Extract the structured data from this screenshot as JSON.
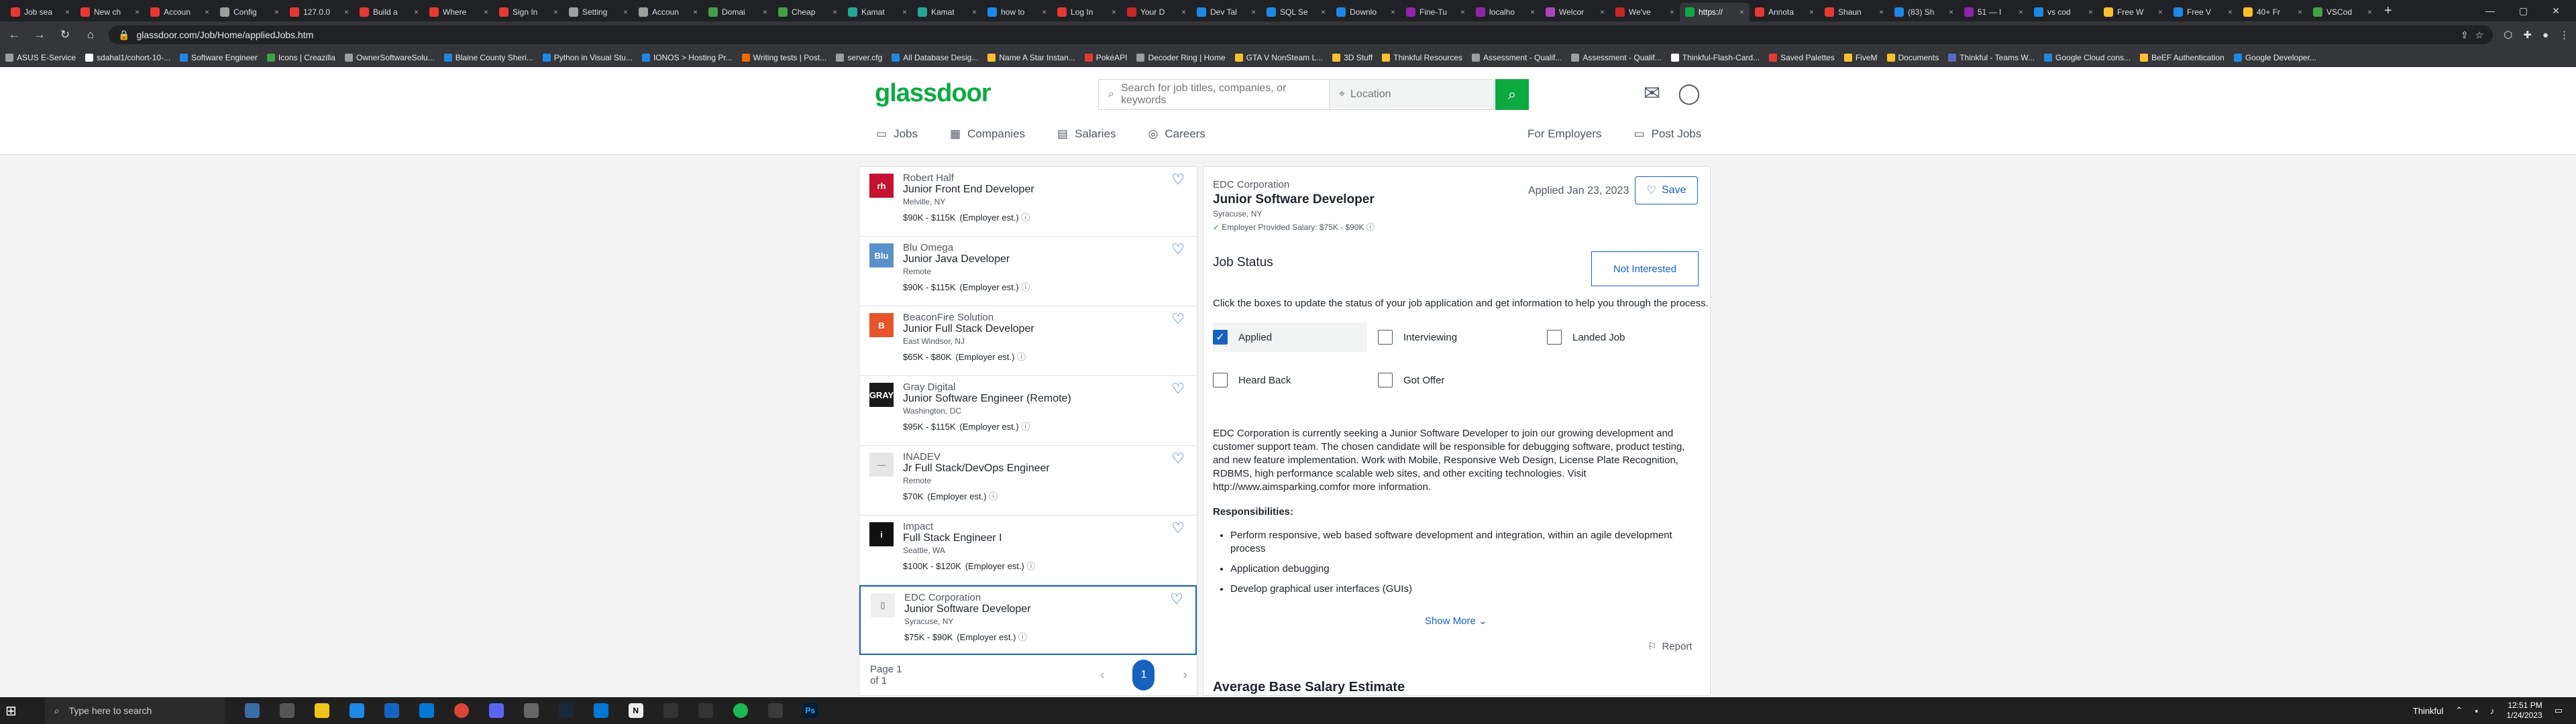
{
  "browser": {
    "tabs": [
      {
        "title": "Job sea",
        "color": "#e53935"
      },
      {
        "title": "New ch",
        "color": "#e53935"
      },
      {
        "title": "Accoun",
        "color": "#e53935"
      },
      {
        "title": "Config",
        "color": "#9e9e9e"
      },
      {
        "title": "127.0.0",
        "color": "#e53935"
      },
      {
        "title": "Build a",
        "color": "#e53935"
      },
      {
        "title": "Where",
        "color": "#e53935"
      },
      {
        "title": "Sign In",
        "color": "#e53935"
      },
      {
        "title": "Setting",
        "color": "#9e9e9e"
      },
      {
        "title": "Accoun",
        "color": "#9e9e9e"
      },
      {
        "title": "Domai",
        "color": "#43a047"
      },
      {
        "title": "Cheap",
        "color": "#43a047"
      },
      {
        "title": "Kamat",
        "color": "#26a69a"
      },
      {
        "title": "Kamat",
        "color": "#26a69a"
      },
      {
        "title": "how to",
        "color": "#1e88e5"
      },
      {
        "title": "Log In",
        "color": "#e53935"
      },
      {
        "title": "Your D",
        "color": "#c62828"
      },
      {
        "title": "Dev Tal",
        "color": "#1e88e5"
      },
      {
        "title": "SQL Se",
        "color": "#1e88e5"
      },
      {
        "title": "Downlo",
        "color": "#1e88e5"
      },
      {
        "title": "Fine-Tu",
        "color": "#8e24aa"
      },
      {
        "title": "localho",
        "color": "#8e24aa"
      },
      {
        "title": "Welcor",
        "color": "#ab47bc"
      },
      {
        "title": "We've",
        "color": "#c62828"
      },
      {
        "title": "https://",
        "color": "#0caa41"
      },
      {
        "title": "Annota",
        "color": "#e53935"
      },
      {
        "title": "Shaun",
        "color": "#e53935"
      },
      {
        "title": "(83) Sh",
        "color": "#1e88e5"
      },
      {
        "title": "51 — I",
        "color": "#8e24aa"
      },
      {
        "title": "vs cod",
        "color": "#1e88e5"
      },
      {
        "title": "Free W",
        "color": "#fbc02d"
      },
      {
        "title": "Free V",
        "color": "#1e88e5"
      },
      {
        "title": "40+ Fr",
        "color": "#fbc02d"
      },
      {
        "title": "VSCod",
        "color": "#43a047"
      }
    ],
    "active_tab_index": 24,
    "url": "glassdoor.com/Job/Home/appliedJobs.htm",
    "bookmarks": [
      {
        "label": "ASUS E-Service",
        "color": "#9e9e9e"
      },
      {
        "label": "sdahal1/cohort-10-...",
        "color": "#ffffff"
      },
      {
        "label": "Software Engineer",
        "color": "#1e88e5"
      },
      {
        "label": "Icons | Creazilla",
        "color": "#43a047"
      },
      {
        "label": "OwnerSoftwareSolu...",
        "color": "#9e9e9e"
      },
      {
        "label": "Blaine County Sheri...",
        "color": "#1e88e5"
      },
      {
        "label": "Python in Visual Stu...",
        "color": "#1e88e5"
      },
      {
        "label": "IONOS > Hosting Pr...",
        "color": "#1e88e5"
      },
      {
        "label": "Writing tests | Post...",
        "color": "#ef6c00"
      },
      {
        "label": "server.cfg",
        "color": "#9e9e9e"
      },
      {
        "label": "All Database Desig...",
        "color": "#1e88e5"
      },
      {
        "label": "Name A Star Instan...",
        "color": "#fbc02d"
      },
      {
        "label": "PokéAPI",
        "color": "#e53935"
      },
      {
        "label": "Decoder Ring | Home",
        "color": "#9e9e9e"
      },
      {
        "label": "GTA V NonSteam L...",
        "color": "#fbc02d"
      },
      {
        "label": "3D Stuff",
        "color": "#fbc02d"
      },
      {
        "label": "Thinkful Resources",
        "color": "#fbc02d"
      },
      {
        "label": "Assessment - Qualif...",
        "color": "#9e9e9e"
      },
      {
        "label": "Assessment - Qualif...",
        "color": "#9e9e9e"
      },
      {
        "label": "Thinkful-Flash-Card...",
        "color": "#ffffff"
      },
      {
        "label": "Saved Palettes",
        "color": "#e53935"
      },
      {
        "label": "FiveM",
        "color": "#fbc02d"
      },
      {
        "label": "Documents",
        "color": "#fbc02d"
      },
      {
        "label": "Thinkful - Teams W...",
        "color": "#5c6bc0"
      },
      {
        "label": "Google Cloud cons...",
        "color": "#1e88e5"
      },
      {
        "label": "BeEF Authentication",
        "color": "#fbc02d"
      },
      {
        "label": "Google Developer...",
        "color": "#1e88e5"
      }
    ]
  },
  "header": {
    "logo": "glassdoor",
    "search_placeholder": "Search for job titles, companies, or keywords",
    "location_placeholder": "Location",
    "nav": [
      "Jobs",
      "Companies",
      "Salaries",
      "Careers"
    ],
    "nav_right": [
      "For Employers",
      "Post Jobs"
    ]
  },
  "jobs": [
    {
      "company": "Robert Half",
      "title": "Junior Front End Developer",
      "location": "Melville, NY",
      "salary": "$90K - $115K",
      "salary_note": "(Employer est.)",
      "logo": "rh",
      "logo_bg": "#c41230"
    },
    {
      "company": "Blu Omega",
      "title": "Junior Java Developer",
      "location": "Remote",
      "salary": "$90K - $115K",
      "salary_note": "(Employer est.)",
      "logo": "Blu",
      "logo_bg": "#5b8fc7"
    },
    {
      "company": "BeaconFire Solution",
      "title": "Junior Full Stack Developer",
      "location": "East Windsor, NJ",
      "salary": "$65K - $80K",
      "salary_note": "(Employer est.)",
      "logo": "B",
      "logo_bg": "#e8542a"
    },
    {
      "company": "Gray Digital",
      "title": "Junior Software Engineer (Remote)",
      "location": "Washington, DC",
      "salary": "$95K - $115K",
      "salary_note": "(Employer est.)",
      "logo": "GRAY",
      "logo_bg": "#1a1a1a"
    },
    {
      "company": "INADEV",
      "title": "Jr Full Stack/DevOps Engineer",
      "location": "Remote",
      "salary": "$70K",
      "salary_note": "(Employer est.)",
      "logo": "—",
      "logo_bg": "#e6e6e6"
    },
    {
      "company": "Impact",
      "title": "Full Stack Engineer I",
      "location": "Seattle, WA",
      "salary": "$100K - $120K",
      "salary_note": "(Employer est.)",
      "logo": "i",
      "logo_bg": "#111111"
    },
    {
      "company": "EDC Corporation",
      "title": "Junior Software Developer",
      "location": "Syracuse, NY",
      "salary": "$75K - $90K",
      "salary_note": "(Employer est.)",
      "logo": "▯",
      "logo_bg": "#eeeeee"
    }
  ],
  "pagination": {
    "label": "Page 1 of 1",
    "current": "1"
  },
  "detail": {
    "company": "EDC Corporation",
    "title": "Junior Software Developer",
    "location": "Syracuse, NY",
    "salary": "Employer Provided Salary: $75K - $90K",
    "applied": "Applied Jan 23, 2023",
    "save_label": "Save",
    "status_heading": "Job Status",
    "status_button": "Not Interested",
    "status_desc": "Click the boxes to update the status of your job application and get information to help you through the process.",
    "statuses": [
      {
        "label": "Applied",
        "checked": true
      },
      {
        "label": "Interviewing",
        "checked": false
      },
      {
        "label": "Landed Job",
        "checked": false
      },
      {
        "label": "Heard Back",
        "checked": false
      },
      {
        "label": "Got Offer",
        "checked": false
      }
    ],
    "description": "EDC Corporation is currently seeking a Junior Software Developer to join our growing development and customer support team. The chosen candidate will be responsible for debugging software, product testing, and new feature implementation. Work with Mobile, Responsive Web Design, License Plate Recognition, RDBMS, high performance scalable web sites, and other exciting technologies. Visit http://www.aimsparking.comfor more information.",
    "responsibilities_heading": "Responsibilities:",
    "responsibilities": [
      "Perform responsive, web based software development and integration, within an agile development process",
      "Application debugging",
      "Develop graphical user interfaces (GUIs)"
    ],
    "show_more": "Show More",
    "report": "Report",
    "section_heading": "Average Base Salary Estimate"
  },
  "taskbar": {
    "search_placeholder": "Type here to search",
    "tray_app": "Thinkful",
    "time": "12:51 PM",
    "date": "1/24/2023"
  }
}
